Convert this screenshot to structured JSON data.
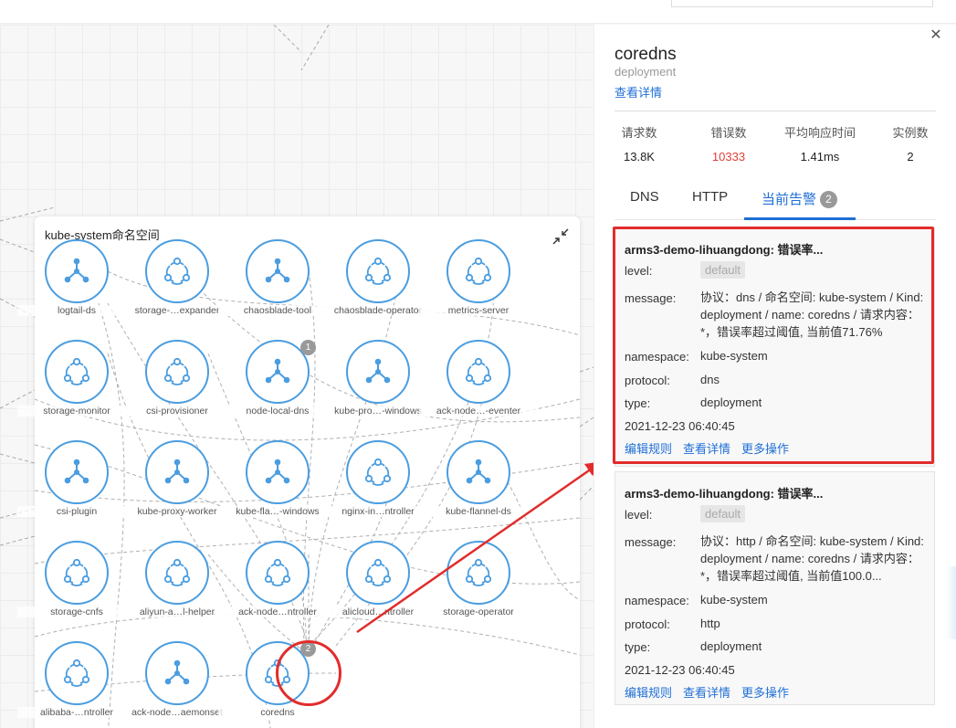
{
  "namespace": {
    "title": "kube-system命名空间",
    "nodes": [
      {
        "label": "logtail-ds",
        "icon": "triad-icon"
      },
      {
        "label": "storage-…expander",
        "icon": "ring-icon"
      },
      {
        "label": "chaosblade-tool",
        "icon": "triad-icon"
      },
      {
        "label": "chaosblade-operator",
        "icon": "ring-icon"
      },
      {
        "label": "metrics-server",
        "icon": "ring-icon"
      },
      {
        "label": "storage-monitor",
        "icon": "ring-icon"
      },
      {
        "label": "csi-provisioner",
        "icon": "ring-icon"
      },
      {
        "label": "node-local-dns",
        "icon": "triad-icon",
        "badge": "1"
      },
      {
        "label": "kube-pro…-windows",
        "icon": "triad-icon"
      },
      {
        "label": "ack-node…-eventer",
        "icon": "ring-icon"
      },
      {
        "label": "csi-plugin",
        "icon": "triad-icon"
      },
      {
        "label": "kube-proxy-worker",
        "icon": "triad-icon"
      },
      {
        "label": "kube-fla…-windows",
        "icon": "triad-icon"
      },
      {
        "label": "nginx-in…ntroller",
        "icon": "ring-icon"
      },
      {
        "label": "kube-flannel-ds",
        "icon": "triad-icon"
      },
      {
        "label": "storage-cnfs",
        "icon": "ring-icon"
      },
      {
        "label": "aliyun-a…l-helper",
        "icon": "ring-icon"
      },
      {
        "label": "ack-node…ntroller",
        "icon": "ring-icon"
      },
      {
        "label": "alicloud…ntroller",
        "icon": "ring-icon"
      },
      {
        "label": "storage-operator",
        "icon": "ring-icon"
      },
      {
        "label": "alibaba-…ntroller",
        "icon": "ring-icon"
      },
      {
        "label": "ack-node…aemonset",
        "icon": "triad-icon"
      },
      {
        "label": "coredns",
        "icon": "ring-icon",
        "badge": "2"
      }
    ]
  },
  "panel": {
    "name": "coredns",
    "type": "deployment",
    "detail_link": "查看详情",
    "metrics": [
      {
        "label": "请求数",
        "value": "13.8K",
        "color": "#222222"
      },
      {
        "label": "错误数",
        "value": "10333",
        "color": "#e0403a"
      },
      {
        "label": "平均响应时间",
        "value": "1.41ms",
        "color": "#222222"
      },
      {
        "label": "实例数",
        "value": "2",
        "color": "#222222"
      }
    ],
    "tabs": {
      "dns": "DNS",
      "http": "HTTP",
      "alerts": "当前告警",
      "alerts_count": "2"
    },
    "alerts": [
      {
        "title": "arms3-demo-lihuangdong: 错误率...",
        "level_key": "level:",
        "level": "default",
        "message_key": "message:",
        "message": "协议：dns / 命名空间: kube-system / Kind: deployment / name: coredns / 请求内容：*，错误率超过阈值, 当前值71.76%",
        "namespace_key": "namespace:",
        "namespace": "kube-system",
        "protocol_key": "protocol:",
        "protocol": "dns",
        "type_key": "type:",
        "type": "deployment",
        "time": "2021-12-23 06:40:45",
        "actions": [
          "编辑规则",
          "查看详情",
          "更多操作"
        ]
      },
      {
        "title": "arms3-demo-lihuangdong: 错误率...",
        "level_key": "level:",
        "level": "default",
        "message_key": "message:",
        "message": "协议：http / 命名空间: kube-system / Kind: deployment / name: coredns / 请求内容：*，错误率超过阈值, 当前值100.0...",
        "namespace_key": "namespace:",
        "namespace": "kube-system",
        "protocol_key": "protocol:",
        "protocol": "http",
        "type_key": "type:",
        "type": "deployment",
        "time": "2021-12-23 06:40:45",
        "actions": [
          "编辑规则",
          "查看详情",
          "更多操作"
        ]
      }
    ]
  },
  "colors": {
    "accent": "#1f6fd6",
    "node": "#4a9de0",
    "highlight": "#e22c2c",
    "error": "#e0403a"
  }
}
